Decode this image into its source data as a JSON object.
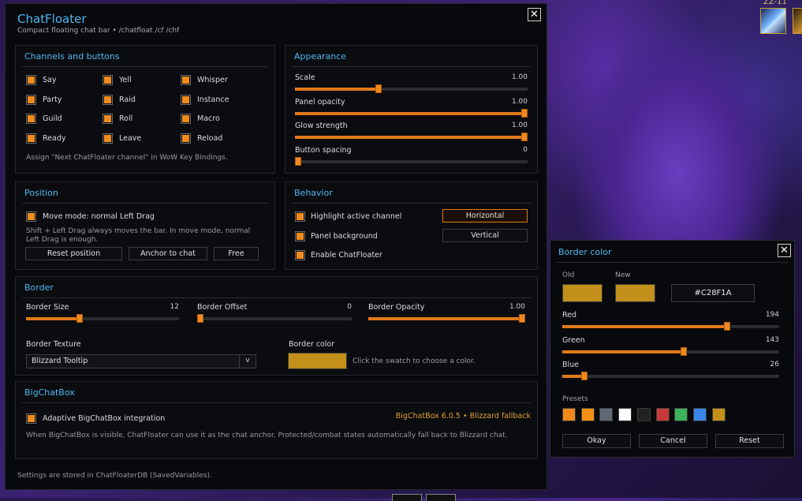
{
  "top_right": {
    "level_text": "ZZ-11"
  },
  "main": {
    "title": "ChatFloater",
    "subtitle": "Compact floating chat bar • /chatfloat /cf /chf",
    "footer": "Settings are stored in ChatFloaterDB (SavedVariables)."
  },
  "channels": {
    "title": "Channels and buttons",
    "items": [
      "Say",
      "Yell",
      "Whisper",
      "Party",
      "Raid",
      "Instance",
      "Guild",
      "Roll",
      "Macro",
      "Ready",
      "Leave",
      "Reload"
    ],
    "note": "Assign \"Next ChatFloater channel\" in WoW Key Bindings."
  },
  "appearance": {
    "title": "Appearance",
    "sliders": [
      {
        "label": "Scale",
        "value_text": "1.00",
        "fraction": 0.36
      },
      {
        "label": "Panel opacity",
        "value_text": "1.00",
        "fraction": 1.0
      },
      {
        "label": "Glow strength",
        "value_text": "1.00",
        "fraction": 1.0
      },
      {
        "label": "Button spacing",
        "value_text": "0",
        "fraction": 0.0
      }
    ]
  },
  "position": {
    "title": "Position",
    "move_label": "Move mode: normal Left Drag",
    "note": "Shift + Left Drag always moves the bar. In move mode, normal Left Drag is enough.",
    "buttons": [
      "Reset position",
      "Anchor to chat",
      "Free"
    ]
  },
  "behavior": {
    "title": "Behavior",
    "options": [
      "Highlight active channel",
      "Panel background",
      "Enable ChatFloater"
    ],
    "orientation": [
      "Horizontal",
      "Vertical"
    ],
    "selected_orientation": "Horizontal"
  },
  "border": {
    "title": "Border",
    "sliders": [
      {
        "label": "Border Size",
        "value_text": "12",
        "fraction": 0.35
      },
      {
        "label": "Border Offset",
        "value_text": "0",
        "fraction": 0.0
      },
      {
        "label": "Border Opacity",
        "value_text": "1.00",
        "fraction": 1.0
      }
    ],
    "texture_label": "Border Texture",
    "texture_value": "Blizzard Tooltip",
    "dropdown_arrow": "v",
    "color_label": "Border color",
    "color_hint": "Click the swatch to choose a color.",
    "color": "#C28F1A"
  },
  "bigchatbox": {
    "title": "BigChatBox",
    "option": "Adaptive BigChatBox integration",
    "status": "BigChatBox 6.0.5 • Blizzard fallback",
    "note": "When BigChatBox is visible, ChatFloater can use it as the chat anchor. Protected/combat states automatically fall back to Blizzard chat."
  },
  "color_dialog": {
    "title": "Border color",
    "old_label": "Old",
    "new_label": "New",
    "hex": "#C28F1A",
    "old_color": "#C28F1A",
    "new_color": "#C28F1A",
    "channels": [
      {
        "label": "Red",
        "value": 194,
        "value_text": "194"
      },
      {
        "label": "Green",
        "value": 143,
        "value_text": "143"
      },
      {
        "label": "Blue",
        "value": 26,
        "value_text": "26"
      }
    ],
    "presets_label": "Presets",
    "presets": [
      "#F08A1C",
      "#F58F14",
      "#5F6873",
      "#FFFFFF",
      "#222222",
      "#C8393A",
      "#3BB35A",
      "#3A86E8",
      "#C28F1A"
    ],
    "buttons": [
      "Okay",
      "Cancel",
      "Reset"
    ]
  },
  "colors": {
    "accent": "#F08A1C",
    "title_blue": "#4FB7F0"
  }
}
